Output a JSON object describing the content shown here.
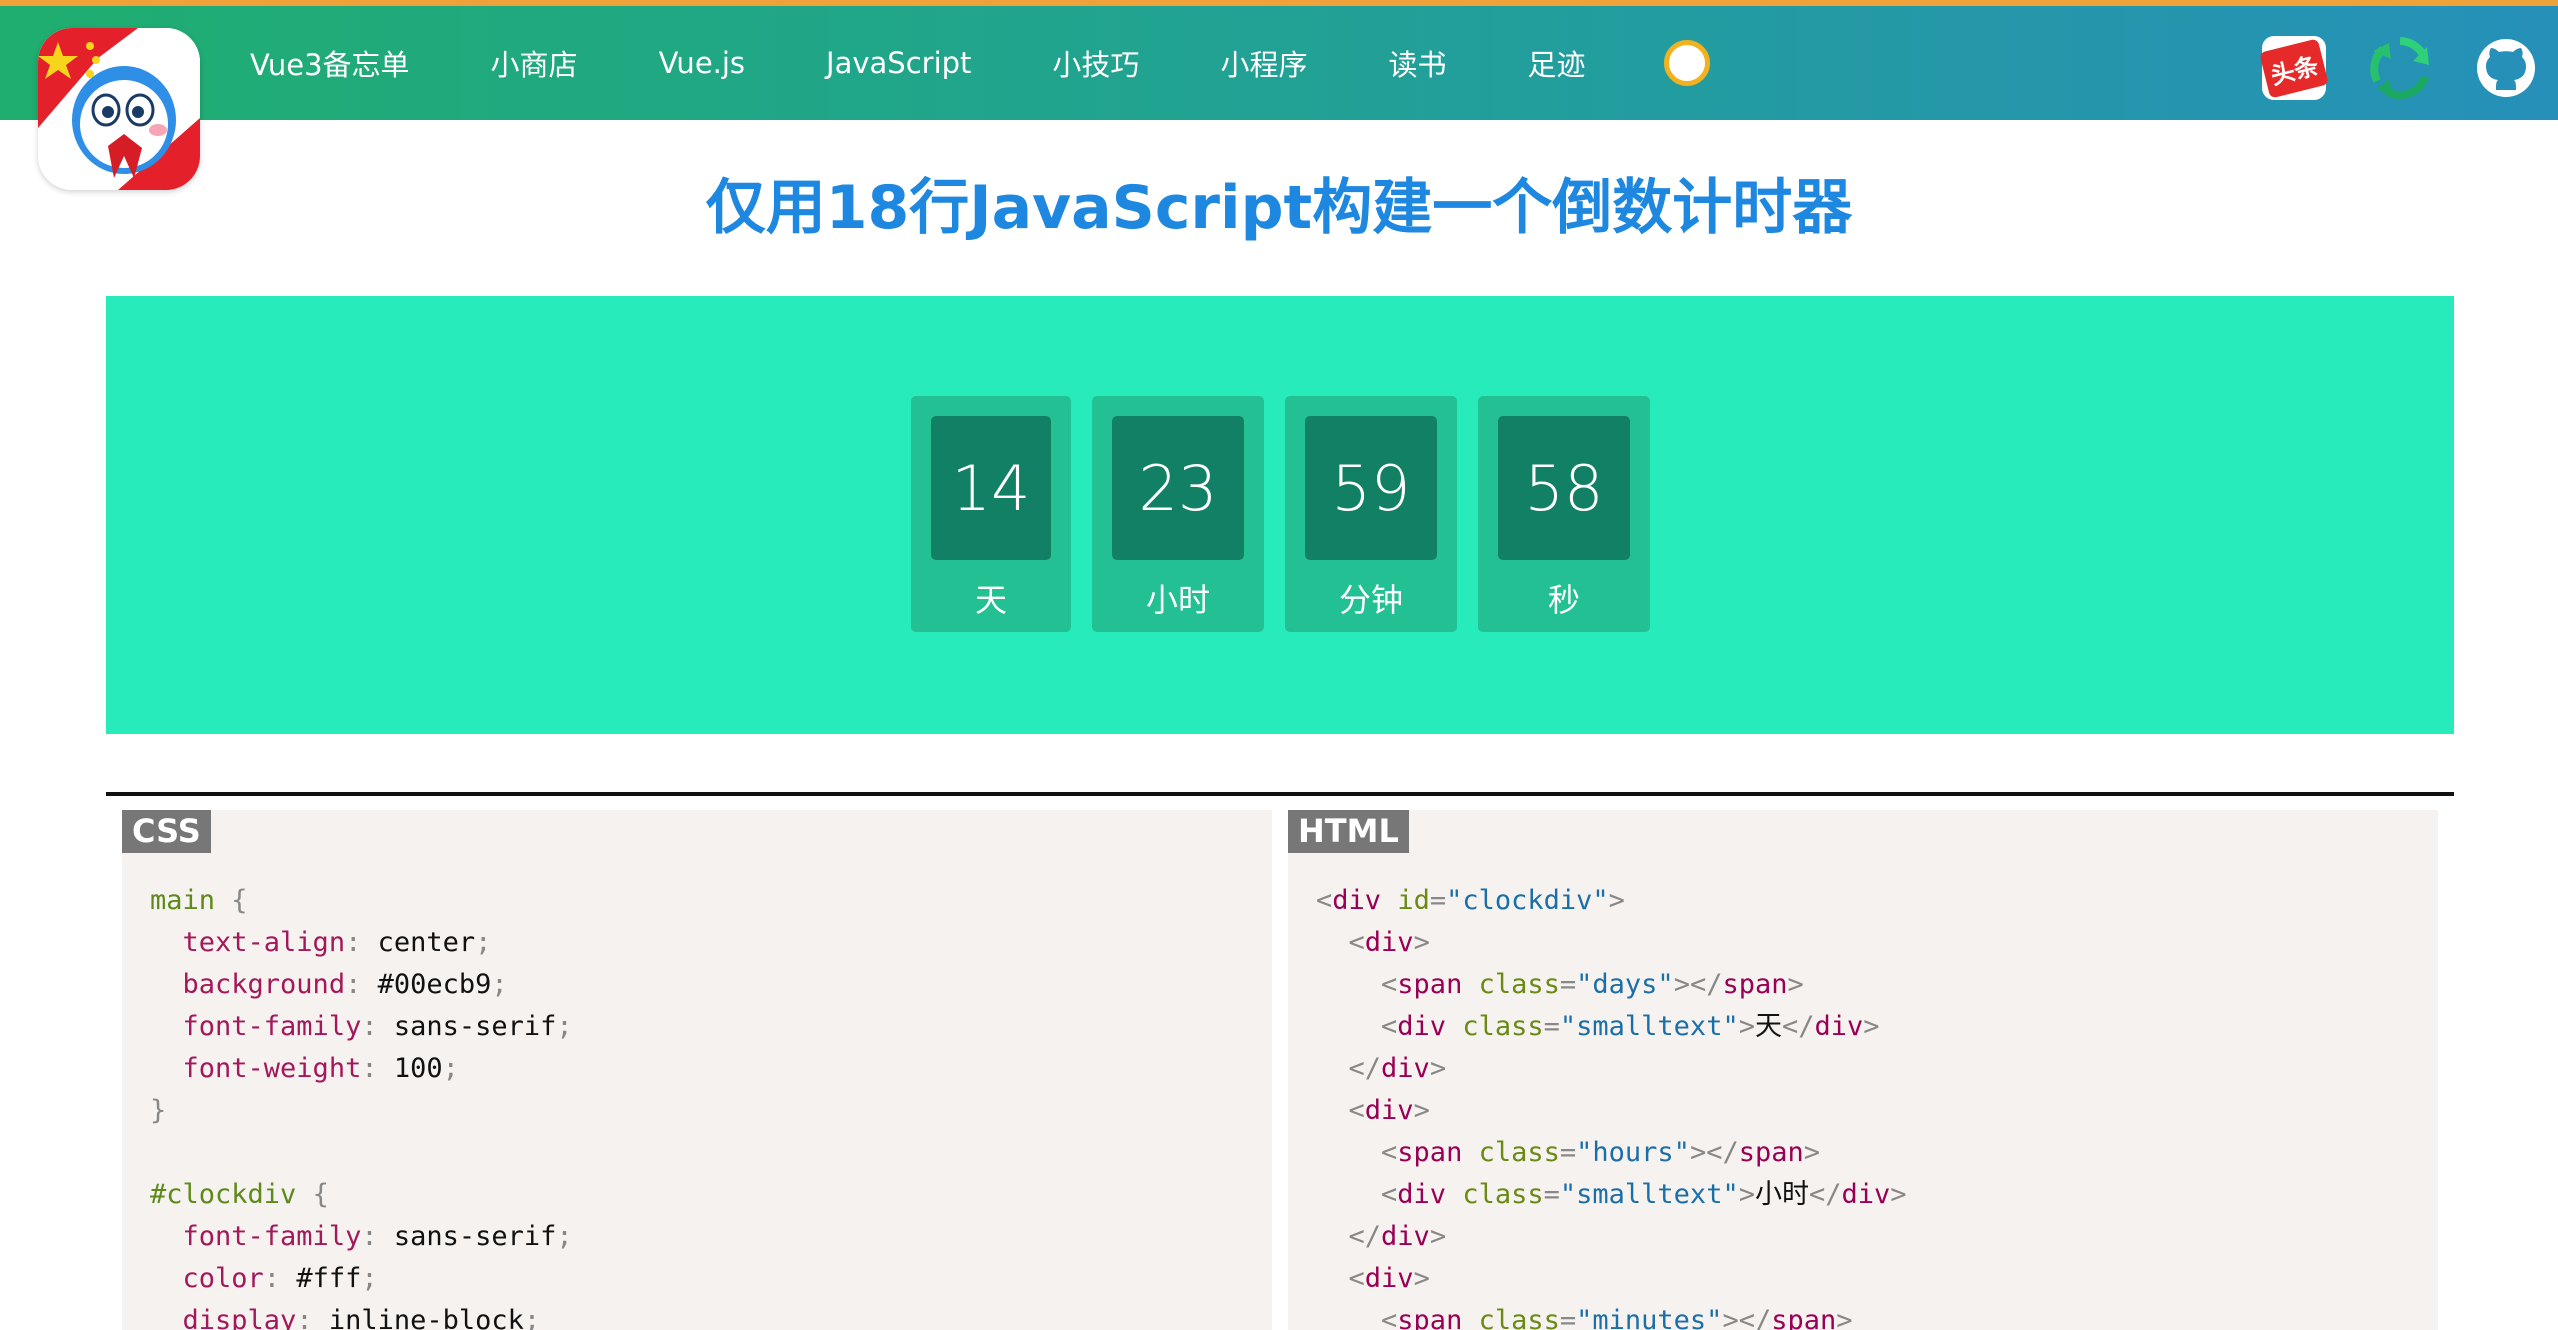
{
  "nav": {
    "items": [
      "Vue3备忘单",
      "小商店",
      "Vue.js",
      "JavaScript",
      "小技巧",
      "小程序",
      "读书",
      "足迹"
    ]
  },
  "right_icons": {
    "toutiao_label": "头条"
  },
  "title": "仅用18行JavaScript构建一个倒数计时器",
  "clock": {
    "units": [
      {
        "value": "14",
        "label": "天"
      },
      {
        "value": "23",
        "label": "小时"
      },
      {
        "value": "59",
        "label": "分钟"
      },
      {
        "value": "58",
        "label": "秒"
      }
    ]
  },
  "panels": {
    "css_tag": "CSS",
    "html_tag": "HTML",
    "css_lines": [
      [
        [
          "sel",
          "main"
        ],
        [
          "punc",
          " {"
        ]
      ],
      [
        [
          "txt",
          "  "
        ],
        [
          "prop",
          "text-align"
        ],
        [
          "punc",
          ": "
        ],
        [
          "val",
          "center"
        ],
        [
          "punc",
          ";"
        ]
      ],
      [
        [
          "txt",
          "  "
        ],
        [
          "prop",
          "background"
        ],
        [
          "punc",
          ": "
        ],
        [
          "val",
          "#00ecb9"
        ],
        [
          "punc",
          ";"
        ]
      ],
      [
        [
          "txt",
          "  "
        ],
        [
          "prop",
          "font-family"
        ],
        [
          "punc",
          ": "
        ],
        [
          "val",
          "sans-serif"
        ],
        [
          "punc",
          ";"
        ]
      ],
      [
        [
          "txt",
          "  "
        ],
        [
          "prop",
          "font-weight"
        ],
        [
          "punc",
          ": "
        ],
        [
          "val",
          "100"
        ],
        [
          "punc",
          ";"
        ]
      ],
      [
        [
          "punc",
          "}"
        ]
      ],
      [
        [
          "txt",
          ""
        ]
      ],
      [
        [
          "sel",
          "#clockdiv"
        ],
        [
          "punc",
          " {"
        ]
      ],
      [
        [
          "txt",
          "  "
        ],
        [
          "prop",
          "font-family"
        ],
        [
          "punc",
          ": "
        ],
        [
          "val",
          "sans-serif"
        ],
        [
          "punc",
          ";"
        ]
      ],
      [
        [
          "txt",
          "  "
        ],
        [
          "prop",
          "color"
        ],
        [
          "punc",
          ": "
        ],
        [
          "val",
          "#fff"
        ],
        [
          "punc",
          ";"
        ]
      ],
      [
        [
          "txt",
          "  "
        ],
        [
          "prop",
          "display"
        ],
        [
          "punc",
          ": "
        ],
        [
          "val",
          "inline-block"
        ],
        [
          "punc",
          ";"
        ]
      ]
    ],
    "html_lines": [
      [
        [
          "br",
          "<"
        ],
        [
          "tag",
          "div"
        ],
        [
          "txt",
          " "
        ],
        [
          "attr",
          "id"
        ],
        [
          "br",
          "="
        ],
        [
          "str",
          "\"clockdiv\""
        ],
        [
          "br",
          ">"
        ]
      ],
      [
        [
          "txt",
          "  "
        ],
        [
          "br",
          "<"
        ],
        [
          "tag",
          "div"
        ],
        [
          "br",
          ">"
        ]
      ],
      [
        [
          "txt",
          "    "
        ],
        [
          "br",
          "<"
        ],
        [
          "tag",
          "span"
        ],
        [
          "txt",
          " "
        ],
        [
          "attr",
          "class"
        ],
        [
          "br",
          "="
        ],
        [
          "str",
          "\"days\""
        ],
        [
          "br",
          "></"
        ],
        [
          "tag",
          "span"
        ],
        [
          "br",
          ">"
        ]
      ],
      [
        [
          "txt",
          "    "
        ],
        [
          "br",
          "<"
        ],
        [
          "tag",
          "div"
        ],
        [
          "txt",
          " "
        ],
        [
          "attr",
          "class"
        ],
        [
          "br",
          "="
        ],
        [
          "str",
          "\"smalltext\""
        ],
        [
          "br",
          ">"
        ],
        [
          "txt",
          "天"
        ],
        [
          "br",
          "</"
        ],
        [
          "tag",
          "div"
        ],
        [
          "br",
          ">"
        ]
      ],
      [
        [
          "txt",
          "  "
        ],
        [
          "br",
          "</"
        ],
        [
          "tag",
          "div"
        ],
        [
          "br",
          ">"
        ]
      ],
      [
        [
          "txt",
          "  "
        ],
        [
          "br",
          "<"
        ],
        [
          "tag",
          "div"
        ],
        [
          "br",
          ">"
        ]
      ],
      [
        [
          "txt",
          "    "
        ],
        [
          "br",
          "<"
        ],
        [
          "tag",
          "span"
        ],
        [
          "txt",
          " "
        ],
        [
          "attr",
          "class"
        ],
        [
          "br",
          "="
        ],
        [
          "str",
          "\"hours\""
        ],
        [
          "br",
          "></"
        ],
        [
          "tag",
          "span"
        ],
        [
          "br",
          ">"
        ]
      ],
      [
        [
          "txt",
          "    "
        ],
        [
          "br",
          "<"
        ],
        [
          "tag",
          "div"
        ],
        [
          "txt",
          " "
        ],
        [
          "attr",
          "class"
        ],
        [
          "br",
          "="
        ],
        [
          "str",
          "\"smalltext\""
        ],
        [
          "br",
          ">"
        ],
        [
          "txt",
          "小时"
        ],
        [
          "br",
          "</"
        ],
        [
          "tag",
          "div"
        ],
        [
          "br",
          ">"
        ]
      ],
      [
        [
          "txt",
          "  "
        ],
        [
          "br",
          "</"
        ],
        [
          "tag",
          "div"
        ],
        [
          "br",
          ">"
        ]
      ],
      [
        [
          "txt",
          "  "
        ],
        [
          "br",
          "<"
        ],
        [
          "tag",
          "div"
        ],
        [
          "br",
          ">"
        ]
      ],
      [
        [
          "txt",
          "    "
        ],
        [
          "br",
          "<"
        ],
        [
          "tag",
          "span"
        ],
        [
          "txt",
          " "
        ],
        [
          "attr",
          "class"
        ],
        [
          "br",
          "="
        ],
        [
          "str",
          "\"minutes\""
        ],
        [
          "br",
          "></"
        ],
        [
          "tag",
          "span"
        ],
        [
          "br",
          ">"
        ]
      ]
    ]
  }
}
